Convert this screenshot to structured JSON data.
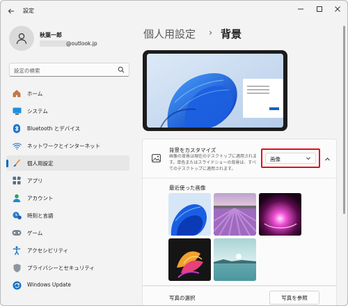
{
  "window": {
    "title": "設定"
  },
  "user": {
    "name": "秋葉一郎",
    "email_visible": "@outlook.jp"
  },
  "search": {
    "placeholder": "設定の検索"
  },
  "sidebar": {
    "items": [
      {
        "label": "ホーム",
        "icon": "home-icon"
      },
      {
        "label": "システム",
        "icon": "system-icon"
      },
      {
        "label": "Bluetooth とデバイス",
        "icon": "bluetooth-icon"
      },
      {
        "label": "ネットワークとインターネット",
        "icon": "wifi-icon"
      },
      {
        "label": "個人用設定",
        "icon": "brush-icon",
        "active": true
      },
      {
        "label": "アプリ",
        "icon": "apps-icon"
      },
      {
        "label": "アカウント",
        "icon": "account-icon"
      },
      {
        "label": "時刻と言語",
        "icon": "time-language-icon"
      },
      {
        "label": "ゲーム",
        "icon": "gamepad-icon"
      },
      {
        "label": "アクセシビリティ",
        "icon": "accessibility-icon"
      },
      {
        "label": "プライバシーとセキュリティ",
        "icon": "shield-icon"
      },
      {
        "label": "Windows Update",
        "icon": "update-icon"
      }
    ]
  },
  "breadcrumb": {
    "parent": "個人用設定",
    "separator": "›",
    "current": "背景"
  },
  "background": {
    "title": "背景をカスタマイズ",
    "description": "画像の背景は現在のデスクトップに適用されます。単色またはスライドショーの背景は、すべてのデスクトップに適用されます。",
    "selected": "画像"
  },
  "recent": {
    "label": "最近使った画像"
  },
  "photo": {
    "label": "写真の選択",
    "button": "写真を参照"
  },
  "colors": {
    "accent": "#0067c0",
    "highlight_border": "#e0101a"
  }
}
